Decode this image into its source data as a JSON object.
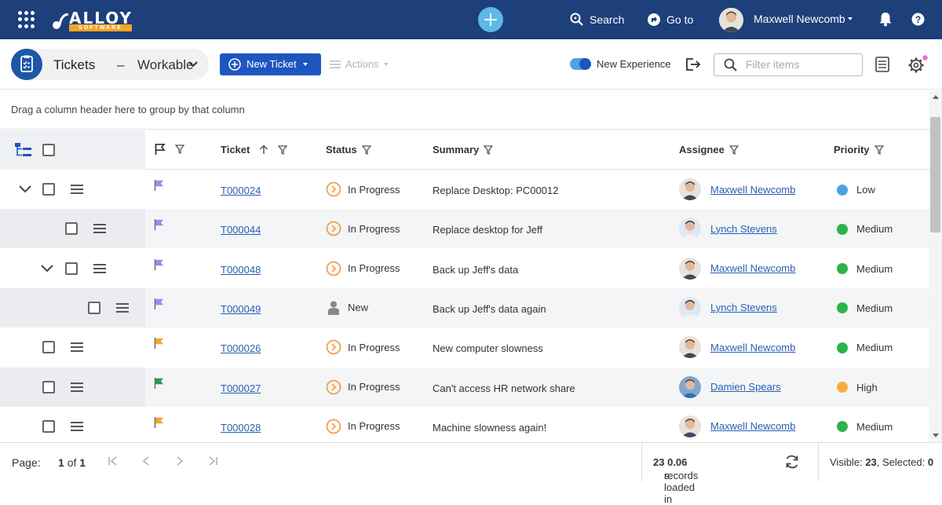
{
  "topbar": {
    "logo_word": "ALLOY",
    "logo_sub": "SOFTWARE",
    "search_label": "Search",
    "goto_label": "Go to",
    "user_name": "Maxwell Newcomb"
  },
  "toolbar": {
    "module_title": "Tickets",
    "separator": "–",
    "view_name": "Workable",
    "new_ticket_label": "New Ticket",
    "actions_label": "Actions",
    "new_experience_label": "New Experience",
    "new_experience_on": true,
    "filter_placeholder": "Filter items"
  },
  "group_hint": "Drag a column header here to group by that column",
  "columns": {
    "ticket": "Ticket",
    "status": "Status",
    "summary": "Summary",
    "assignee": "Assignee",
    "priority": "Priority"
  },
  "rows": [
    {
      "ticket": "T000024",
      "status": "In Progress",
      "summary": "Replace Desktop: PC00012",
      "assignee": "Maxwell Newcomb",
      "priority": "Low"
    },
    {
      "ticket": "T000044",
      "status": "In Progress",
      "summary": "Replace desktop for Jeff",
      "assignee": "Lynch Stevens",
      "priority": "Medium"
    },
    {
      "ticket": "T000048",
      "status": "In Progress",
      "summary": "Back up Jeff's data",
      "assignee": "Maxwell Newcomb",
      "priority": "Medium"
    },
    {
      "ticket": "T000049",
      "status": "New",
      "summary": "Back up Jeff's data again",
      "assignee": "Lynch Stevens",
      "priority": "Medium"
    },
    {
      "ticket": "T000026",
      "status": "In Progress",
      "summary": "New computer slowness",
      "assignee": "Maxwell Newcomb",
      "priority": "Medium"
    },
    {
      "ticket": "T000027",
      "status": "In Progress",
      "summary": "Can't access HR network share",
      "assignee": "Damien Spears",
      "priority": "High"
    },
    {
      "ticket": "T000028",
      "status": "In Progress",
      "summary": "Machine slowness again!",
      "assignee": "Maxwell Newcomb",
      "priority": "Medium"
    }
  ],
  "row_flags": [
    "#9b8be8",
    "#9b8be8",
    "#9b8be8",
    "#9b8be8",
    "#f4a62a",
    "#2e9a4a",
    "#f4a62a"
  ],
  "priority_colors": {
    "Low": "#4aa3e8",
    "Medium": "#2db34a",
    "High": "#f4ad3c"
  },
  "footer": {
    "page_label": "Page:",
    "page_current": "1",
    "page_of": "of",
    "page_total": "1",
    "records_count": "23",
    "records_text": "records loaded in",
    "load_time": "0.06",
    "load_unit": "s",
    "visible_label": "Visible:",
    "visible_count": "23",
    "selected_label": "Selected:",
    "selected_count": "0"
  },
  "colors": {
    "topbar": "#1d3f7a",
    "accent": "#1e56c0",
    "link": "#2a5fb0"
  }
}
